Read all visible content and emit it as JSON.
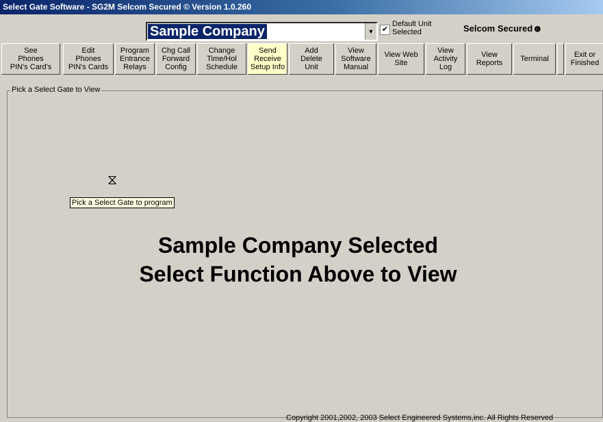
{
  "window": {
    "title": "Select Gate Software - SG2M Selcom Secured © Version 1.0.260"
  },
  "company_combo": {
    "value": "Sample Company"
  },
  "default_unit": {
    "checked": true,
    "label": "Default Unit\nSelected"
  },
  "secured_label": "Selcom Secured",
  "toolbar": {
    "buttons": [
      {
        "label": "See\nPhones\nPIN's Card's"
      },
      {
        "label": "Edit\nPhones\nPIN's Cards"
      },
      {
        "label": "Program\nEntrance\nRelays"
      },
      {
        "label": "Chg Call\nForward\nConfig"
      },
      {
        "label": "Change\nTime/Hol\nSchedule"
      },
      {
        "label": "Send\nReceive\nSetup Info"
      },
      {
        "label": "Add\nDelete\nUnit"
      },
      {
        "label": "View\nSoftware\nManual"
      },
      {
        "label": "View Web\nSite"
      },
      {
        "label": "View\nActivity\nLog"
      },
      {
        "label": "View\nReports"
      },
      {
        "label": "Terminal"
      },
      {
        "label": ""
      },
      {
        "label": "Exit or\nFinished"
      }
    ]
  },
  "group": {
    "legend": "Pick a Select Gate to View"
  },
  "tooltip": "Pick a Select Gate to program",
  "message": {
    "line1": "Sample Company Selected",
    "line2": "Select Function Above to View"
  },
  "copyright": "Copyright 2001,2002, 2003  Select Engineered Systems,inc. All Rights Reserved"
}
